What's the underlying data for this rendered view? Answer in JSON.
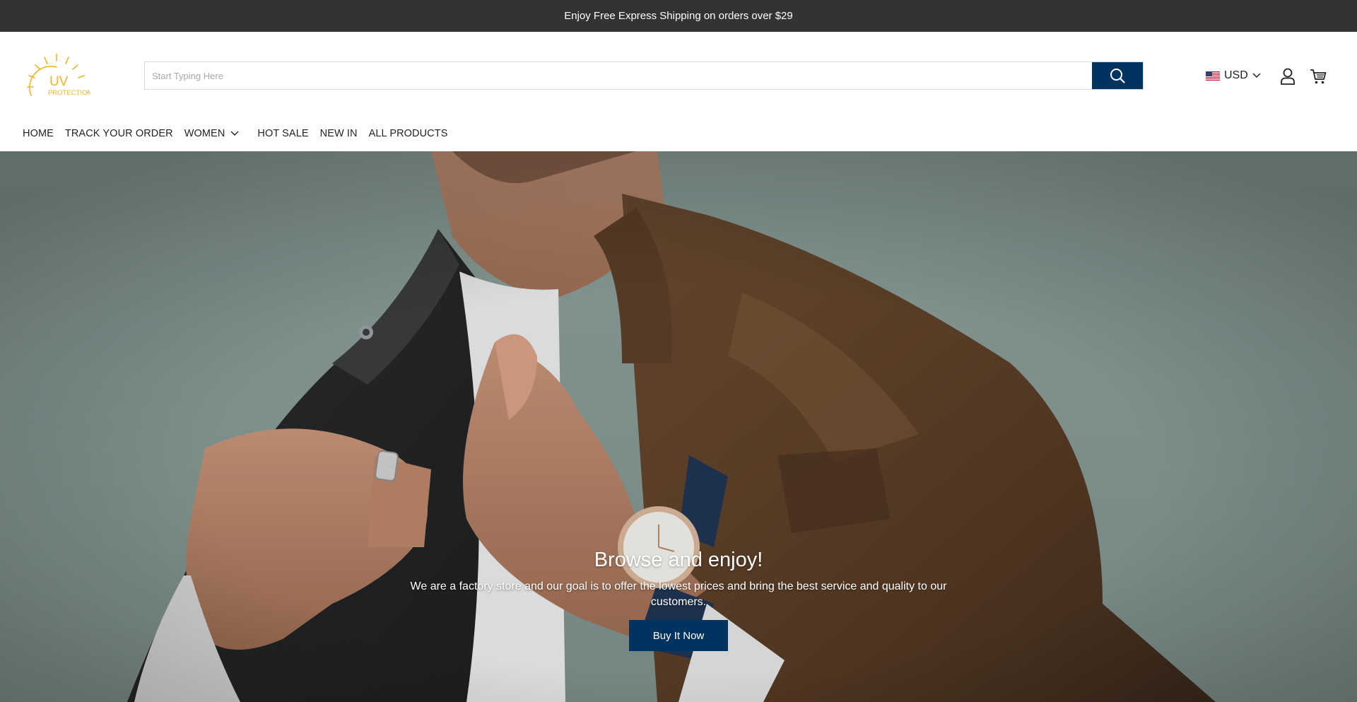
{
  "announcement": {
    "text": "Enjoy Free Express Shipping on orders over $29"
  },
  "header": {
    "logo": {
      "line1": "UV",
      "line2": "PROTECTION",
      "color": "#f0b429"
    },
    "search": {
      "placeholder": "Start Typing Here",
      "value": "",
      "button_icon": "search-icon"
    },
    "currency": {
      "flag_icon": "us-flag-icon",
      "label": "USD"
    },
    "icons": {
      "account": "account-icon",
      "cart": "cart-icon"
    }
  },
  "nav": {
    "items": [
      {
        "label": "HOME"
      },
      {
        "label": "TRACK YOUR ORDER"
      },
      {
        "label": "WOMEN",
        "has_dropdown": true
      },
      {
        "label": "HOT SALE"
      },
      {
        "label": "NEW IN"
      },
      {
        "label": "ALL PRODUCTS"
      }
    ]
  },
  "hero": {
    "title": "Browse and enjoy!",
    "subtitle": "We are a factory store and our goal is to offer the lowest prices and bring the best service and quality to our customers.",
    "button_label": "Buy It Now"
  },
  "colors": {
    "announcement_bg": "#333333",
    "accent": "#00335f",
    "logo": "#f0b429"
  }
}
